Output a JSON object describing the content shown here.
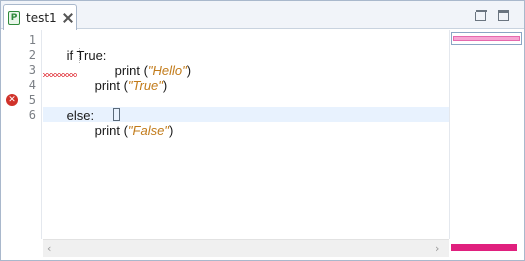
{
  "tab": {
    "icon": "P",
    "title": "test1"
  },
  "lines": [
    {
      "num": "1"
    },
    {
      "num": "2"
    },
    {
      "num": "3"
    },
    {
      "num": "4"
    },
    {
      "num": "5"
    },
    {
      "num": "6"
    }
  ],
  "code": {
    "l1": "if True:",
    "l2_pre": "print (",
    "l2_str": "\"Hello\"",
    "l2_post": ")",
    "l3_pre": "print (",
    "l3_str": "\"True\"",
    "l3_post": ")",
    "l5": "else:",
    "l6_pre": "print (",
    "l6_str": "\"False\"",
    "l6_post": ")"
  },
  "icons": {
    "error": "error-icon",
    "close": "close-icon",
    "minimize": "minimize-icon",
    "maximize": "maximize-icon",
    "scroll_left": "‹",
    "scroll_right": "›"
  },
  "colors": {
    "string": "#c27b1a",
    "error": "#d0322a",
    "current_line": "#e8f2fe",
    "overview_marker": "#e0207e"
  }
}
